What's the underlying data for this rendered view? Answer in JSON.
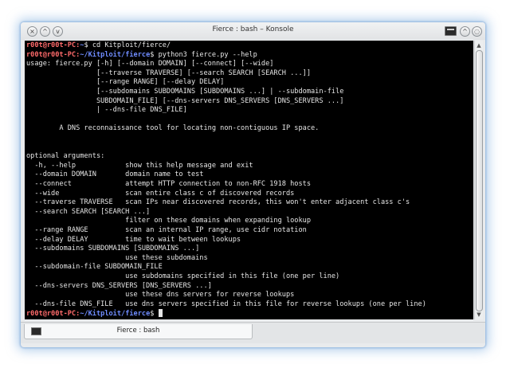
{
  "window": {
    "title": "Fierce : bash – Konsole",
    "buttons": {
      "close": "×",
      "minimize": "^",
      "maximize": "v",
      "keep_above": "^",
      "extra": "◌"
    }
  },
  "terminal": {
    "lines": [
      {
        "user": "r00t@r00t-PC",
        "sep": ":",
        "path": "~",
        "cmd": "$ cd Kitploit/fierce/"
      },
      {
        "user": "r00t@r00t-PC",
        "sep": ":",
        "path": "~/Kitploit/fierce",
        "cmd": "$ python3 fierce.py --help"
      },
      {
        "text": "usage: fierce.py [-h] [--domain DOMAIN] [--connect] [--wide]"
      },
      {
        "text": "                 [--traverse TRAVERSE] [--search SEARCH [SEARCH ...]]"
      },
      {
        "text": "                 [--range RANGE] [--delay DELAY]"
      },
      {
        "text": "                 [--subdomains SUBDOMAINS [SUBDOMAINS ...] | --subdomain-file"
      },
      {
        "text": "                 SUBDOMAIN_FILE] [--dns-servers DNS_SERVERS [DNS_SERVERS ...]"
      },
      {
        "text": "                 | --dns-file DNS_FILE]"
      },
      {
        "text": ""
      },
      {
        "text": "        A DNS reconnaissance tool for locating non-contiguous IP space."
      },
      {
        "text": ""
      },
      {
        "text": ""
      },
      {
        "text": "optional arguments:"
      },
      {
        "text": "  -h, --help            show this help message and exit"
      },
      {
        "text": "  --domain DOMAIN       domain name to test"
      },
      {
        "text": "  --connect             attempt HTTP connection to non-RFC 1918 hosts"
      },
      {
        "text": "  --wide                scan entire class c of discovered records"
      },
      {
        "text": "  --traverse TRAVERSE   scan IPs near discovered records, this won't enter adjacent class c's"
      },
      {
        "text": "  --search SEARCH [SEARCH ...]"
      },
      {
        "text": "                        filter on these domains when expanding lookup"
      },
      {
        "text": "  --range RANGE         scan an internal IP range, use cidr notation"
      },
      {
        "text": "  --delay DELAY         time to wait between lookups"
      },
      {
        "text": "  --subdomains SUBDOMAINS [SUBDOMAINS ...]"
      },
      {
        "text": "                        use these subdomains"
      },
      {
        "text": "  --subdomain-file SUBDOMAIN_FILE"
      },
      {
        "text": "                        use subdomains specified in this file (one per line)"
      },
      {
        "text": "  --dns-servers DNS_SERVERS [DNS_SERVERS ...]"
      },
      {
        "text": "                        use these dns servers for reverse lookups"
      },
      {
        "text": "  --dns-file DNS_FILE   use dns servers specified in this file for reverse lookups (one per line)"
      },
      {
        "user": "r00t@r00t-PC",
        "sep": ":",
        "path": "~/Kitploit/fierce",
        "cmd": "$ ",
        "cursor": true
      }
    ]
  },
  "tabs": [
    {
      "label": "Fierce : bash"
    }
  ],
  "colors": {
    "prompt_user": "#ff6b6b",
    "prompt_path": "#6f8cff",
    "terminal_bg": "#000000",
    "terminal_fg": "#e6e6e6"
  }
}
